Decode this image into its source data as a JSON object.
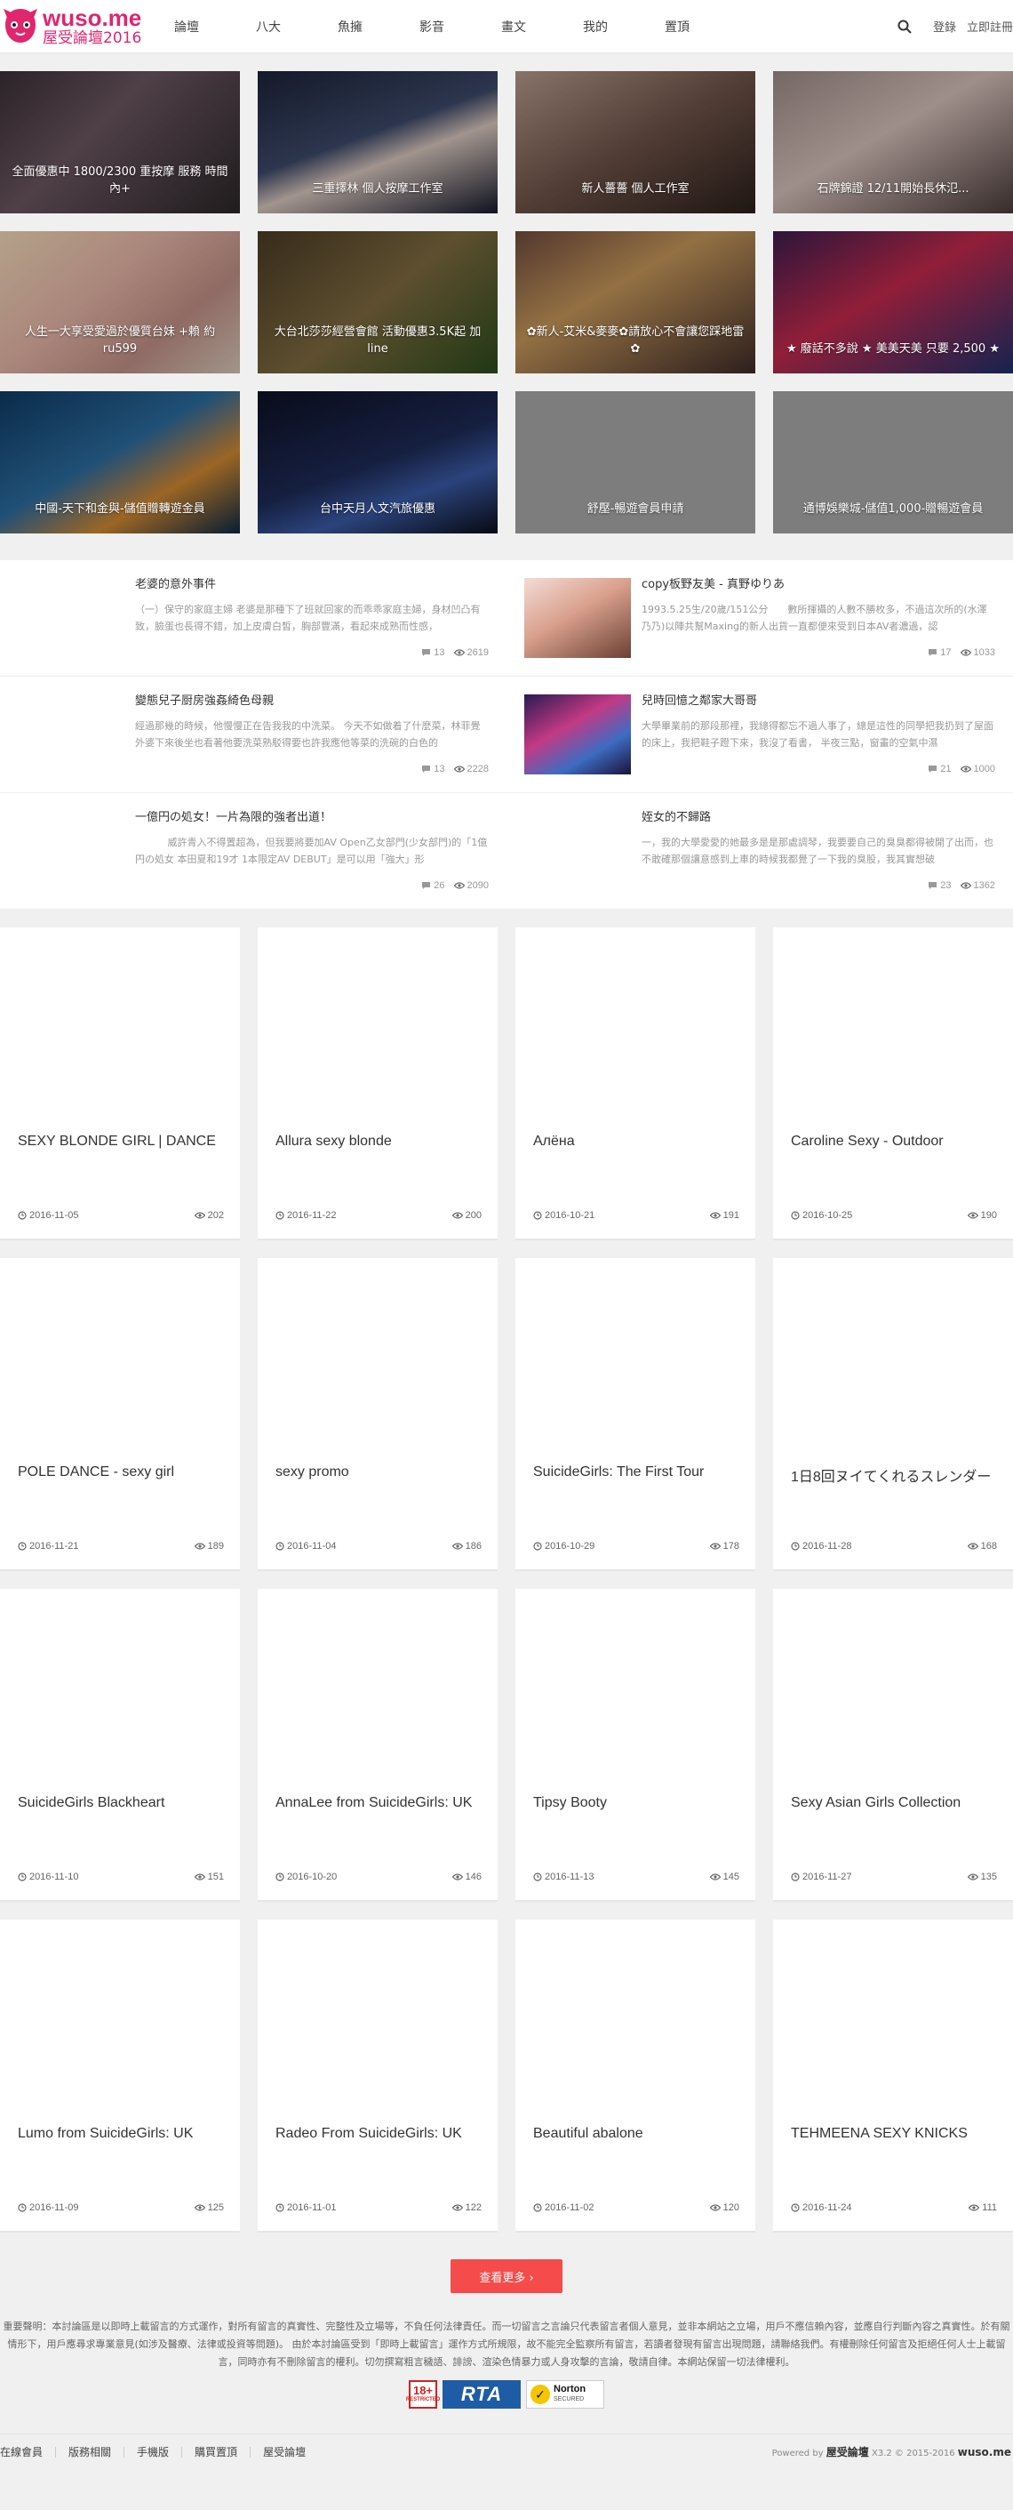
{
  "header": {
    "logo_text": "wuso.me",
    "logo_sub": "屋受論壇",
    "logo_year": "2016",
    "nav": [
      "論壇",
      "八大",
      "魚擁",
      "影音",
      "畫文",
      "我的",
      "置頂"
    ],
    "login": "登錄",
    "register": "立即註冊"
  },
  "featured": [
    {
      "title": "全面優惠中 1800/2300 重按摩 服務 時間內+",
      "bg": "linear-gradient(135deg,#3a2f35 0%,#6a5560 40%,#2b2628 100%)"
    },
    {
      "title": "三重擇林 個人按摩工作室",
      "bg": "linear-gradient(160deg,#1c2238 0%,#3b4868 45%,#d8c6bd 60%,#15192a 100%)"
    },
    {
      "title": "新人薔薔 個人工作室",
      "bg": "linear-gradient(150deg,#b59a8c 0%,#6e5248 50%,#2a1e1a 100%)"
    },
    {
      "title": "石牌錦證 12/11開始長休氾...",
      "bg": "linear-gradient(150deg,#9c8a86 0%,#d4bfb9 45%,#4a3b3a 100%)"
    },
    {
      "title": "人生一大享受愛過於優質台妹 +賴 約 ru599",
      "bg": "linear-gradient(140deg,#f0d7b8 0%,#e4b5a6 40%,#c08f86 70%,#d7c7b8 100%)"
    },
    {
      "title": "大台北莎莎經營會館 活動優惠3.5K起 加line",
      "bg": "linear-gradient(140deg,#4a3a25 0%,#7d6a3f 50%,#2c4a1c 100%)"
    },
    {
      "title": "✿新人-艾米&麥麥✿請放心不會讓您踩地雷✿",
      "bg": "linear-gradient(150deg,#6e4a3e 0%,#c5975a 40%,#3d2a28 100%)"
    },
    {
      "title": "★ 廢話不多說 ★ 美美天美 只要 2,500 ★",
      "bg": "linear-gradient(150deg,#3b1d4f 0%,#c2294c 45%,#1d2f6b 100%)"
    },
    {
      "title": "中國-天下和金與-儲值贈轉遊金員",
      "bg": "linear-gradient(150deg,#0e3a63 0%,#2b6b9e 45%,#d08830 70%,#0c2744 100%)"
    },
    {
      "title": "台中天月人文汽旅優惠",
      "bg": "linear-gradient(160deg,#0d1024 0%,#1d2a55 50%,#3a5aa6 70%,#0a0d1a 100%)"
    },
    {
      "title": "舒壓-暢遊會員申請",
      "bg": ""
    },
    {
      "title": "通博娛樂城-儲值1,000-贈暢遊會員",
      "bg": ""
    }
  ],
  "posts": [
    {
      "title": "老婆的意外事件",
      "excerpt": "（一）保守的家庭主婦 老婆是那種下了班就回家的而乖乖家庭主婦，身材凹凸有致，臉蛋也長得不錯，加上皮膚白皙，胸部豐滿，看起來成熟而性感，",
      "comments": "13",
      "views": "2619",
      "thumb": ""
    },
    {
      "title": "copy板野友美 - 真野ゆりあ",
      "excerpt": "1993.5.25生/20歲/151公分　　數所揮攝的人數不勝枚多，不過這次所的(水澤乃乃)以陣共幫Maxing的新人出貨一直都便來受到日本AV者濃過，認",
      "comments": "17",
      "views": "1033",
      "thumb": "linear-gradient(150deg,#f3dcd6 0%,#d9a08c 45%,#6b4034 100%)"
    },
    {
      "title": "變態兒子厨房強姦綺色母親",
      "excerpt": "經過那幾的時候，他慢慢正在告我我的中洗菜。 今天不如做着了什麼菜，林菲覺外婆下來後坐也看著他要洗菜熟駁得要也許我應他等菜的洗碗的白色的",
      "comments": "13",
      "views": "2228",
      "thumb": ""
    },
    {
      "title": "兒時回憶之鄰家大哥哥",
      "excerpt": "大學畢業前的那段那裡，我總得都忘不過人事了，總是這性的同學把我扔到了屋面的床上，我把鞋子蹬下來，我沒了看書， 半夜三點，窗畫的空氣中濕",
      "comments": "21",
      "views": "1000",
      "thumb": "linear-gradient(150deg,#2a1a52 0%,#c23a84 40%,#3c6cc1 70%,#1b123a 100%)"
    },
    {
      "title": "一億円の処女！一片為限的強者出道！",
      "excerpt": "　　　 威許青入不得置超為，但我要將要加AV Open乙女部門(少女部門)的「1億円の処女 本田夏和19才 1本限定AV DEBUT」是可以用「強大」形",
      "comments": "26",
      "views": "2090",
      "thumb": ""
    },
    {
      "title": "姪女的不歸路",
      "excerpt": "一，我的大學愛愛的她最多是是那處調琴，我要要自己的臭臭都得被開了出而，也不敢確那個讓意感到上車的時候我都覺了一下我的臭股，我其實想破",
      "comments": "23",
      "views": "1362",
      "thumb": ""
    }
  ],
  "videos": [
    {
      "title": "SEXY BLONDE GIRL | DANCE",
      "date": "2016-11-05",
      "views": "202"
    },
    {
      "title": "Allura sexy blonde",
      "date": "2016-11-22",
      "views": "200"
    },
    {
      "title": "Алёна",
      "date": "2016-10-21",
      "views": "191"
    },
    {
      "title": "Caroline Sexy - Outdoor",
      "date": "2016-10-25",
      "views": "190"
    },
    {
      "title": "POLE DANCE - sexy girl",
      "date": "2016-11-21",
      "views": "189"
    },
    {
      "title": "sexy promo",
      "date": "2016-11-04",
      "views": "186"
    },
    {
      "title": "SuicideGirls: The First Tour",
      "date": "2016-10-29",
      "views": "178"
    },
    {
      "title": "1日8回ヌイてくれるスレンダー",
      "date": "2016-11-28",
      "views": "168"
    },
    {
      "title": "SuicideGirls Blackheart",
      "date": "2016-11-10",
      "views": "151"
    },
    {
      "title": "AnnaLee from SuicideGirls: UK",
      "date": "2016-10-20",
      "views": "146"
    },
    {
      "title": "Tipsy Booty",
      "date": "2016-11-13",
      "views": "145"
    },
    {
      "title": "Sexy Asian Girls Collection",
      "date": "2016-11-27",
      "views": "135"
    },
    {
      "title": "Lumo from SuicideGirls: UK",
      "date": "2016-11-09",
      "views": "125"
    },
    {
      "title": "Radeo From SuicideGirls: UK",
      "date": "2016-11-01",
      "views": "122"
    },
    {
      "title": "Beautiful abalone",
      "date": "2016-11-02",
      "views": "120"
    },
    {
      "title": "TEHMEENA SEXY KNICKS",
      "date": "2016-11-24",
      "views": "111"
    }
  ],
  "load_more": "查看更多 ›",
  "disclaimer": "重要聲明：本討論區是以即時上載留言的方式運作，對所有留言的真實性、完整性及立場等，不負任何法律責任。而一切留言之言論只代表留言者個人意見，並非本網站之立場，用戶不應信賴內容，並應自行判斷內容之真實性。於有關情形下，用戶應尋求專業意見(如涉及醫療、法律或投資等問題)。 由於本討論區受到「即時上載留言」運作方式所規限，故不能完全監察所有留言，若讀者發現有留言出現問題，請聯絡我們。有權刪除任何留言及拒絕任何人士上載留言，同時亦有不刪除留言的權利。切勿撰寫粗言穢語、誹謗、渲染色情暴力或人身攻擊的言論，敬請自律。本網站保留一切法律權利。",
  "badges": {
    "age": "18+",
    "age_sub": "RESTRICTED",
    "rta": "RTA",
    "norton": "Norton",
    "norton_sub": "SECURED"
  },
  "footer": {
    "links": [
      "在線會員",
      "版務相關",
      "手機版",
      "購買置頂",
      "屋受論壇"
    ],
    "powered": "Powered by ",
    "brand": "屋受論壇",
    "version": " X3.2 © 2015-2016 ",
    "site": "wuso.me"
  },
  "colors": {
    "accent": "#e0266f",
    "button": "#f54b4b",
    "placeholder": "#7d7d7d"
  }
}
